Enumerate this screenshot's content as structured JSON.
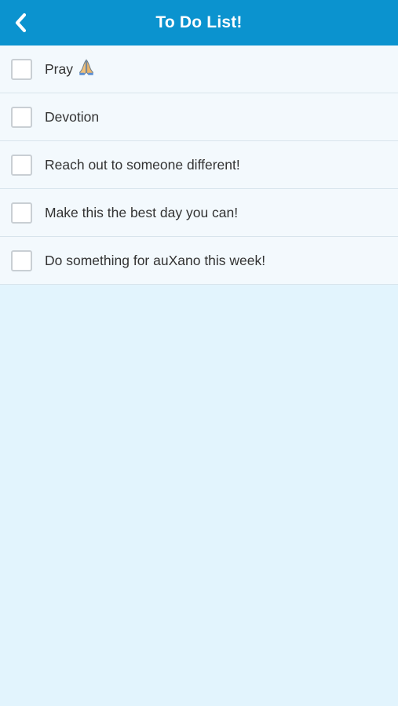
{
  "header": {
    "title": "To Do List!",
    "back_icon": "chevron-left-icon"
  },
  "colors": {
    "header_bg": "#0b93cf",
    "page_bg": "#e2f4fd",
    "list_bg": "#f3f9fd"
  },
  "todos": [
    {
      "label": "Pray",
      "checked": false,
      "icon": "praying-hands-icon"
    },
    {
      "label": "Devotion",
      "checked": false
    },
    {
      "label": "Reach out to someone different!",
      "checked": false
    },
    {
      "label": "Make this the best day you can!",
      "checked": false
    },
    {
      "label": "Do something for auXano this week!",
      "checked": false
    }
  ]
}
